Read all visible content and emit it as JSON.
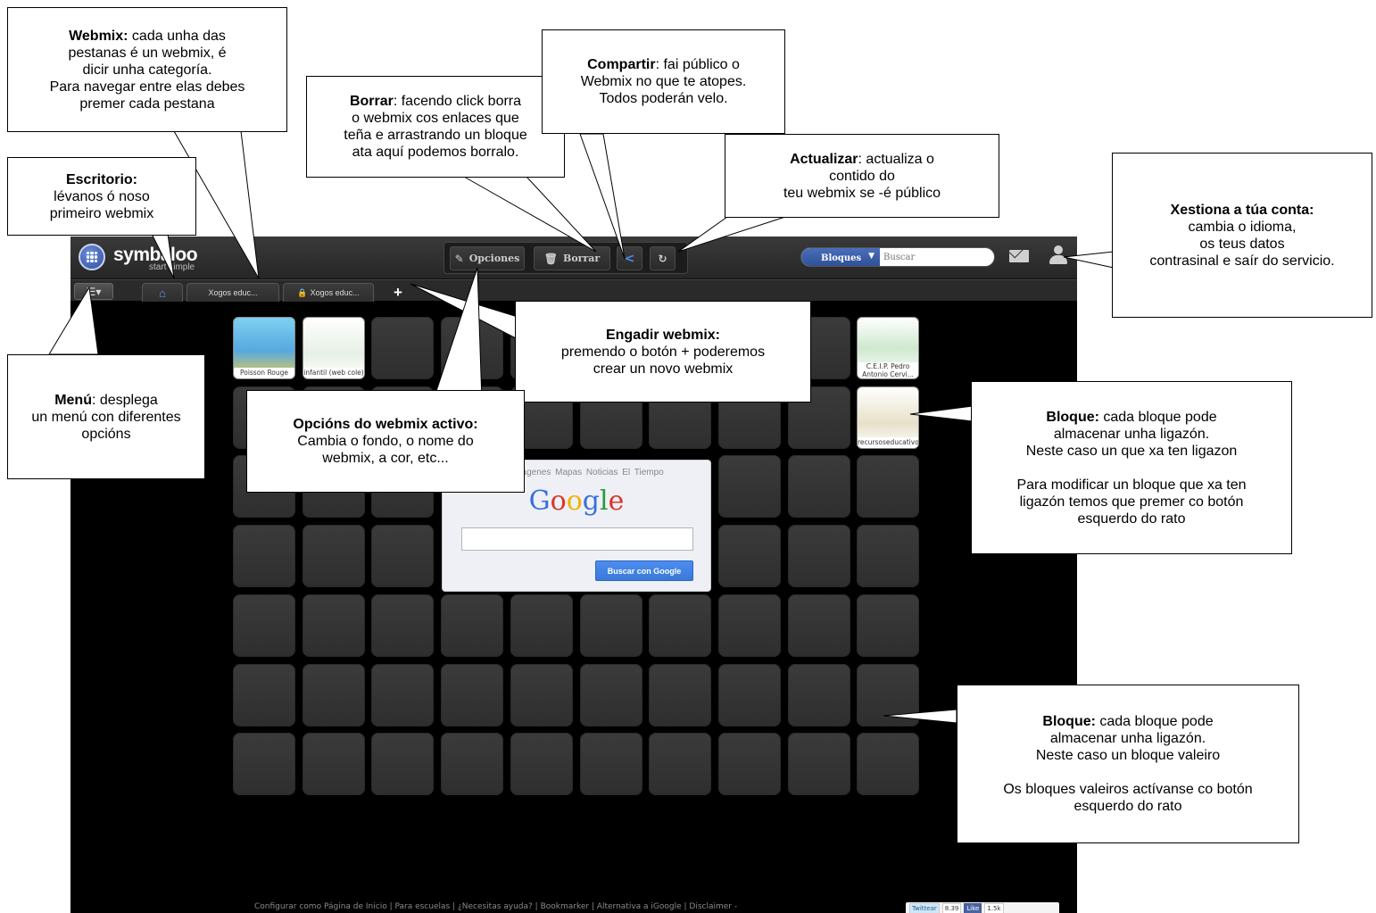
{
  "app": {
    "logo_text": "symbaloo",
    "logo_tagline": "start simple",
    "toolbar": {
      "options_label": "Opciones",
      "delete_label": "Borrar"
    },
    "search": {
      "scope_label": "Bloques",
      "placeholder": "Buscar"
    },
    "tabs": [
      {
        "label": "Xogos educ..."
      },
      {
        "label": "Xogos educ..."
      }
    ],
    "tiles": [
      {
        "caption": "Poisson Rouge"
      },
      {
        "caption": "infantil (web cole)"
      },
      {
        "caption": "C.E.I.P. Pedro Antonio Cervi..."
      },
      {
        "caption": "recursoseducativos"
      }
    ],
    "google_widget": {
      "links": "Web  Imágenes  Mapas  Noticias  El Tiempo",
      "button_label": "Buscar con Google"
    },
    "footer_links": "Configurar como Página de Inicio  |  Para escuelas  |  ¿Necesitas ayuda?  |  Bookmarker  |  Alternativa a iGoogle  |  Disclaimer  -",
    "social": {
      "twitter": "Twittear",
      "twitter_count": "8.39",
      "like": "Like",
      "like_count": "1.5k"
    }
  },
  "callouts": {
    "webmix": {
      "title": "Webmix:",
      "body": "cada unha das\npestanas é un webmix, é\ndicir unha categoría.\nPara navegar entre elas debes\npremer cada pestana"
    },
    "escritorio": {
      "title": "Escritorio:",
      "body": "lévanos ó noso\nprimeiro webmix"
    },
    "borrar": {
      "title": "Borrar",
      "body": ": facendo click borra\no webmix cos enlaces que\nteña e arrastrando un bloque\nata aquí podemos borralo."
    },
    "compartir": {
      "title": "Compartir",
      "body": ": fai público o\nWebmix no que te atopes.\nTodos poderán velo."
    },
    "actualizar": {
      "title": "Actualizar",
      "body": ": actualiza o\ncontido do\nteu webmix se -é público"
    },
    "xestiona": {
      "title": "Xestiona a túa conta:",
      "body": "cambia o idioma,\nos teus datos\ncontrasinal e saír do servicio."
    },
    "menu": {
      "title": "Menú",
      "body": ": desplega\nun menú con diferentes\nopcións"
    },
    "engadir": {
      "title": "Engadir webmix:",
      "body": "premendo o botón + poderemos\ncrear un novo webmix"
    },
    "opcions": {
      "title": "Opcións do webmix activo:",
      "body": "Cambia o fondo, o nome do\nwebmix, a cor, etc..."
    },
    "bloque_full": {
      "title": "Bloque:",
      "body": " cada bloque pode\nalmacenar unha ligazón.\nNeste caso un que xa ten ligazon\n\nPara modificar un bloque que xa ten\nligazón temos que premer co botón\nesquerdo do rato"
    },
    "bloque_empty": {
      "title": "Bloque:",
      "body": " cada bloque pode\nalmacenar unha ligazón.\nNeste caso un bloque valeiro\n\nOs bloques valeiros actívanse co botón\nesquerdo do rato"
    }
  },
  "colors": {
    "accent": "#3a78d8",
    "topbar": "#2f2f2f",
    "tile": "#353535"
  }
}
